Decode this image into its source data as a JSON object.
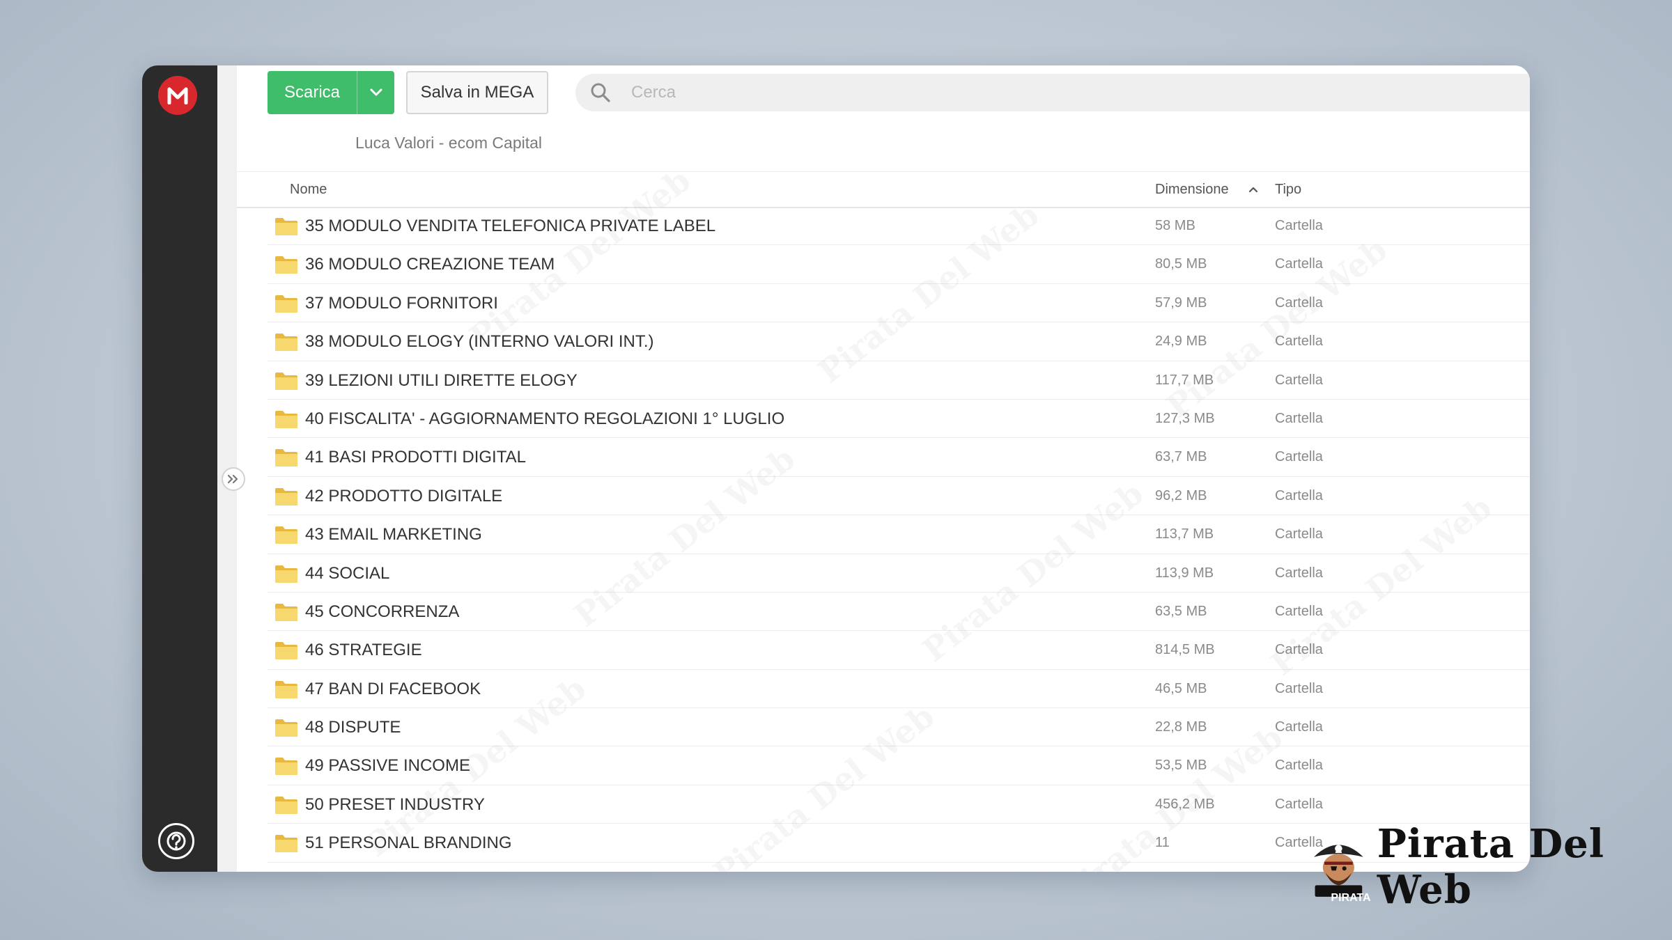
{
  "toolbar": {
    "download_label": "Scarica",
    "save_label": "Salva in MEGA"
  },
  "search": {
    "placeholder": "Cerca"
  },
  "breadcrumb": "Luca Valori - ecom Capital",
  "columns": {
    "name": "Nome",
    "size": "Dimensione",
    "type": "Tipo"
  },
  "rows": [
    {
      "name": "35 MODULO VENDITA TELEFONICA PRIVATE LABEL",
      "size": "58 MB",
      "type": "Cartella"
    },
    {
      "name": "36 MODULO CREAZIONE TEAM",
      "size": "80,5 MB",
      "type": "Cartella"
    },
    {
      "name": "37 MODULO FORNITORI",
      "size": "57,9 MB",
      "type": "Cartella"
    },
    {
      "name": "38 MODULO ELOGY (INTERNO VALORI INT.)",
      "size": "24,9 MB",
      "type": "Cartella"
    },
    {
      "name": "39 LEZIONI UTILI DIRETTE ELOGY",
      "size": "117,7 MB",
      "type": "Cartella"
    },
    {
      "name": "40 FISCALITA' - AGGIORNAMENTO REGOLAZIONI 1° LUGLIO",
      "size": "127,3 MB",
      "type": "Cartella"
    },
    {
      "name": "41 BASI PRODOTTI DIGITAL",
      "size": "63,7 MB",
      "type": "Cartella"
    },
    {
      "name": "42 PRODOTTO DIGITALE",
      "size": "96,2 MB",
      "type": "Cartella"
    },
    {
      "name": "43 EMAIL MARKETING",
      "size": "113,7 MB",
      "type": "Cartella"
    },
    {
      "name": "44 SOCIAL",
      "size": "113,9 MB",
      "type": "Cartella"
    },
    {
      "name": "45 CONCORRENZA",
      "size": "63,5 MB",
      "type": "Cartella"
    },
    {
      "name": "46 STRATEGIE",
      "size": "814,5 MB",
      "type": "Cartella"
    },
    {
      "name": "47 BAN DI FACEBOOK",
      "size": "46,5 MB",
      "type": "Cartella"
    },
    {
      "name": "48 DISPUTE",
      "size": "22,8 MB",
      "type": "Cartella"
    },
    {
      "name": "49 PASSIVE INCOME",
      "size": "53,5 MB",
      "type": "Cartella"
    },
    {
      "name": "50 PRESET INDUSTRY",
      "size": "456,2 MB",
      "type": "Cartella"
    },
    {
      "name": "51 PERSONAL BRANDING",
      "size": "11",
      "type": "Cartella"
    }
  ],
  "watermark": "Pirata Del Web",
  "brand": {
    "name": "Pirata Del Web",
    "badge": "PIRATA"
  },
  "colors": {
    "accent_green": "#3fbd6a",
    "mega_red": "#d9272e",
    "sidebar": "#2b2b2b",
    "folder": "#f3cf5e"
  },
  "icons": [
    "mega-logo-icon",
    "chevron-down-icon",
    "search-icon",
    "double-chevron-right-icon",
    "help-icon",
    "sort-up-icon",
    "folder-icon"
  ]
}
